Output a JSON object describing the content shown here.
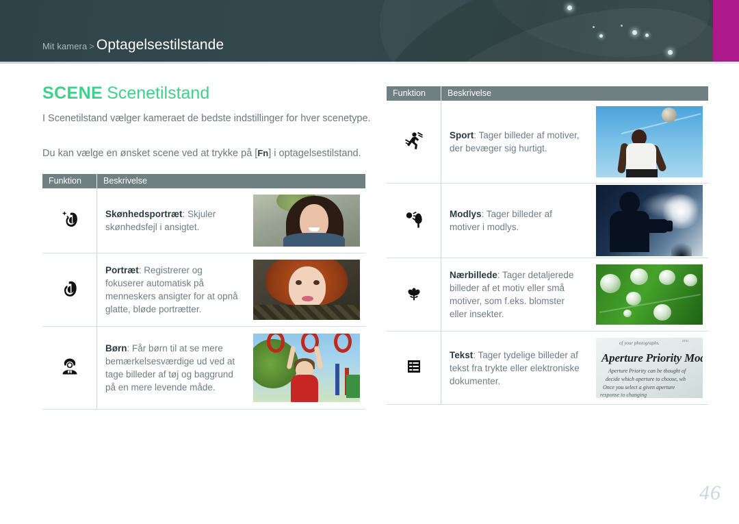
{
  "header": {
    "breadcrumb_parent": "Mit kamera",
    "breadcrumb_separator": ">",
    "breadcrumb_current": "Optagelsestilstande",
    "accent_magenta": "#ad1a8e",
    "banner_color": "#2e4448"
  },
  "page": {
    "title_badge": "SCENE",
    "title": "Scenetilstand",
    "title_color": "#3fd18a",
    "intro_1": "I Scenetilstand vælger kameraet de bedste indstillinger for hver scenetype.",
    "intro_2_before": "Du kan vælge en ønsket scene ved at trykke på [",
    "intro_2_key": "Fn",
    "intro_2_after": "] i optagelsestilstand.",
    "page_number": "46"
  },
  "tables": [
    {
      "id": "left",
      "columns": [
        "Funktion",
        "Beskrivelse"
      ],
      "rows": [
        {
          "icon": "beauty-face-sparkle-icon",
          "term": "Skønhedsportræt",
          "description": ": Skjuler skønhedsfejl i ansigtet.",
          "photo": "woman-smiling-portrait-photo"
        },
        {
          "icon": "face-profile-icon",
          "term": "Portræt",
          "description": ": Registrerer og fokuserer automatisk på menneskers ansigter for at opnå glatte, bløde portrætter.",
          "photo": "red-haired-girl-portrait-photo"
        },
        {
          "icon": "child-bust-icon",
          "term": "Børn",
          "description": ": Får børn til at se mere bemærkelsesværdige ud ved at tage billeder af tøj og baggrund på en mere levende måde.",
          "photo": "child-on-playground-photo"
        }
      ]
    },
    {
      "id": "right",
      "columns": [
        "Funktion",
        "Beskrivelse"
      ],
      "rows": [
        {
          "icon": "running-person-icon",
          "term": "Sport",
          "description": ": Tager billeder af motiver, der bevæger sig hurtigt.",
          "photo": "soccer-player-heading-ball-photo"
        },
        {
          "icon": "sun-behind-tree-icon",
          "term": "Modlys",
          "description": ": Tager billeder af motiver i modlys.",
          "photo": "backlit-photographer-silhouette-photo"
        },
        {
          "icon": "tulip-macro-icon",
          "term": "Nærbillede",
          "description": ": Tager detaljerede billeder af et motiv eller små motiver, som f.eks. blomster eller insekter.",
          "photo": "water-drops-on-leaf-photo"
        },
        {
          "icon": "text-lines-icon",
          "term": "Tekst",
          "description": ": Tager tydelige billeder af tekst fra trykte eller elektroniske dokumenter.",
          "photo": "printed-text-document-photo"
        }
      ]
    }
  ],
  "photo_text": {
    "doc_tiny": "of your photographs.",
    "doc_tiny2": "anu",
    "doc_heading": "Aperture Priority Mode",
    "doc_line1": "Aperture Priority can be thought of",
    "doc_line2": "decide which aperture to choose, wh",
    "doc_line3": "Once you select a given aperture",
    "doc_line4": "response to changing"
  }
}
